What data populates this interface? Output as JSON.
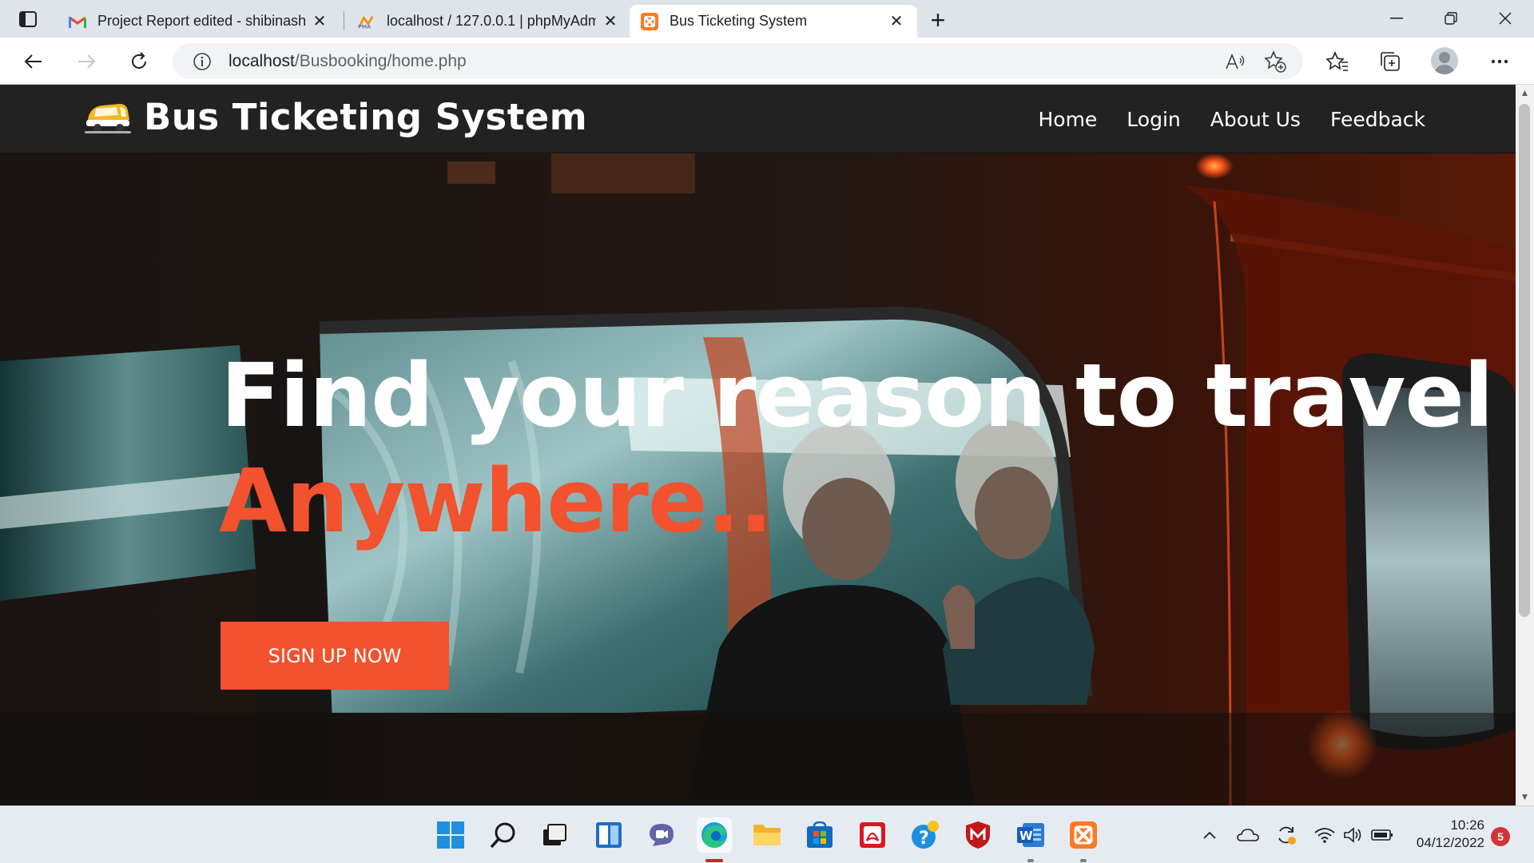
{
  "browser": {
    "tabs": [
      {
        "title": "Project Report edited - shibinash",
        "icon": "gmail-icon"
      },
      {
        "title": "localhost / 127.0.0.1 | phpMyAdmin",
        "icon": "phpmyadmin-icon"
      },
      {
        "title": "Bus Ticketing System",
        "icon": "xampp-icon",
        "active": true
      }
    ],
    "url_host": "localhost",
    "url_path": "/Busbooking/home.php"
  },
  "site": {
    "brand": "Bus Ticketing System",
    "nav": [
      "Home",
      "Login",
      "About Us",
      "Feedback"
    ],
    "hero": {
      "title": "Find your reason to travel",
      "subtitle": "Anywhere..",
      "cta": "SIGN UP NOW"
    }
  },
  "taskbar": {
    "apps": [
      "start-icon",
      "search-icon",
      "task-view-icon",
      "widgets-icon",
      "teams-chat-icon",
      "edge-icon",
      "file-explorer-icon",
      "microsoft-store-icon",
      "acrobat-icon",
      "help-icon",
      "mcafee-icon",
      "word-icon",
      "xampp-icon"
    ],
    "time": "10:26",
    "date": "04/12/2022",
    "notifications": "5"
  },
  "colors": {
    "accent": "#f2522e",
    "nav_background": "#222222"
  }
}
